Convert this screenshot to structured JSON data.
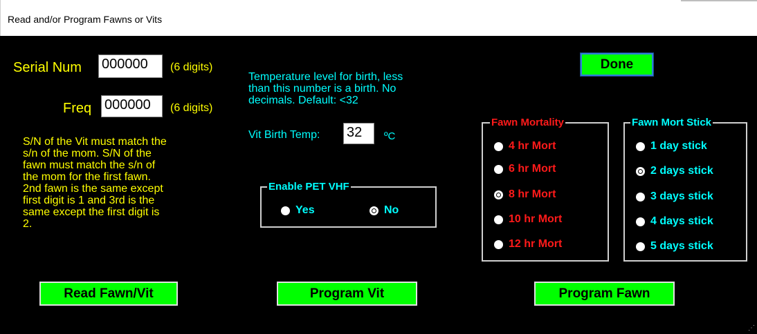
{
  "window": {
    "title": "Read and/or Program Fawns or Vits"
  },
  "serial": {
    "label": "Serial Num",
    "value": "000000",
    "hint": "(6 digits)"
  },
  "freq": {
    "label": "Freq",
    "value": "000000",
    "hint": "(6 digits)"
  },
  "note": {
    "lines": [
      "S/N of the Vit must match the",
      "s/n of the mom. S/N of the",
      "fawn must match the s/n of",
      "the mom for the first fawn.",
      "2nd fawn is the same except",
      "first digit is 1 and 3rd is the",
      "same except the first digit is",
      "2."
    ]
  },
  "temp": {
    "desc_lines": [
      "Temperature level for birth, less",
      "than this number is a birth. No",
      "decimals. Default: <32"
    ],
    "label": "Vit Birth Temp:",
    "value": "32",
    "unit": "ºC"
  },
  "pet_vhf": {
    "legend": "Enable PET VHF",
    "options": [
      {
        "label": "Yes",
        "selected": false
      },
      {
        "label": "No",
        "selected": true
      }
    ]
  },
  "fawn_mortality": {
    "legend": "Fawn Mortality",
    "options": [
      {
        "label": "4 hr Mort",
        "selected": false
      },
      {
        "label": "6 hr Mort",
        "selected": false
      },
      {
        "label": "8 hr Mort",
        "selected": true
      },
      {
        "label": "10 hr Mort",
        "selected": false
      },
      {
        "label": "12 hr Mort",
        "selected": false
      }
    ]
  },
  "fawn_mort_stick": {
    "legend": "Fawn Mort Stick",
    "options": [
      {
        "label": "1 day stick",
        "selected": false
      },
      {
        "label": "2 days stick",
        "selected": true
      },
      {
        "label": "3 days stick",
        "selected": false
      },
      {
        "label": "4 days stick",
        "selected": false
      },
      {
        "label": "5 days stick",
        "selected": false
      }
    ]
  },
  "buttons": {
    "done": "Done",
    "read": "Read Fawn/Vit",
    "program_vit": "Program Vit",
    "program_fawn": "Program Fawn"
  },
  "colors": {
    "background": "#000000",
    "label": "#ffff00",
    "accent": "#00ffff",
    "mort": "#ff1a1a",
    "button": "#00ff00"
  }
}
